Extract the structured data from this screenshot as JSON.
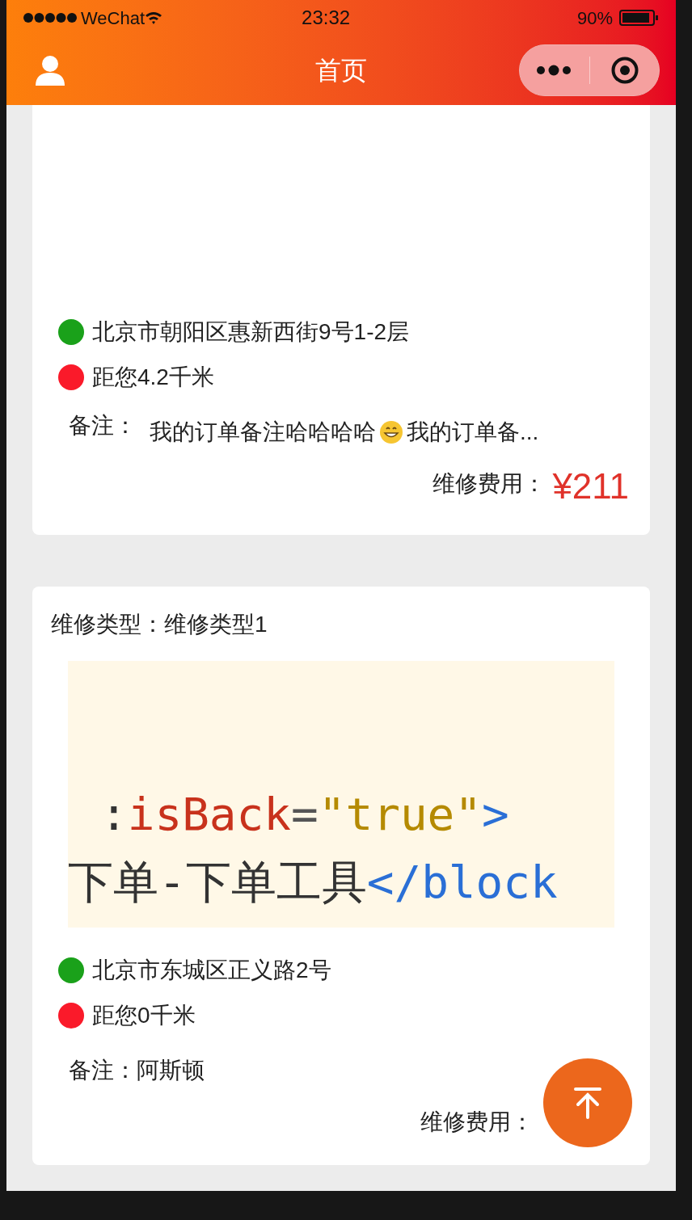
{
  "status_bar": {
    "carrier": "WeChat",
    "time": "23:32",
    "battery": "90%"
  },
  "nav": {
    "title": "首页"
  },
  "orders": [
    {
      "address": "北京市朝阳区惠新西街9号1-2层",
      "distance": "距您4.2千米",
      "note_label": "备注：",
      "note_segments": [
        {
          "kind": "text",
          "text": "我的订单备注哈哈哈哈"
        },
        {
          "kind": "emoji"
        },
        {
          "kind": "text",
          "text": "我的订单备..."
        }
      ],
      "fee_label": "维修费用：",
      "fee": "¥211"
    },
    {
      "type_label": "维修类型：",
      "type_value": "维修类型1",
      "picture": {
        "kind": "code",
        "lines": [
          [
            {
              "text": ":",
              "color": "#333333"
            },
            {
              "text": "isBack",
              "color": "#c8321c"
            },
            {
              "text": "=",
              "color": "#555555"
            },
            {
              "text": "\"true\"",
              "color": "#b58a00"
            },
            {
              "text": ">",
              "color": "#2a6fd6"
            }
          ],
          [
            {
              "text": "下单-下单工具",
              "color": "#333333"
            },
            {
              "text": "</block",
              "color": "#2a6fd6"
            }
          ]
        ]
      },
      "address": "北京市东城区正义路2号",
      "distance": "距您0千米",
      "note_label": "备注：",
      "note_segments": [
        {
          "kind": "text",
          "text": "阿斯顿"
        }
      ],
      "fee_label": "维修费用："
    }
  ]
}
